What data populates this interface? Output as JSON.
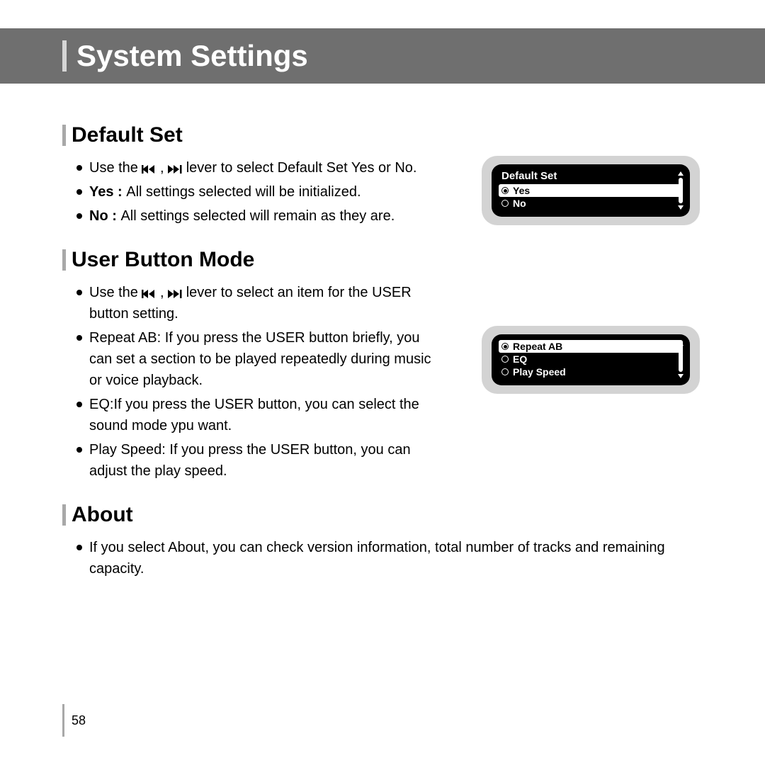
{
  "header": {
    "title": "System Settings"
  },
  "page_number": "58",
  "sections": {
    "default_set": {
      "title": "Default Set",
      "line1_a": "Use the ",
      "line1_b": " lever  to select Default Set Yes or No.",
      "yes_label": "Yes : ",
      "yes_text": "All settings selected will be initialized.",
      "no_label": "No : ",
      "no_text": "All settings selected will remain as they are.",
      "screen": {
        "title": "Default Set",
        "opt_selected": "Yes",
        "opt_other": "No"
      }
    },
    "user_button": {
      "title": "User Button Mode",
      "line1_a": "Use the ",
      "line1_b": " lever to select an item for the USER button setting.",
      "line2": "Repeat AB: If you press the USER button briefly, you can set a section to be played repeatedly during music or voice playback.",
      "line3": "EQ:If you press the USER button, you can select the sound mode ypu want.",
      "line4": "Play Speed: If you press the USER button, you can adjust the play speed.",
      "screen": {
        "opt_selected": "Repeat AB",
        "opt2": "EQ",
        "opt3": "Play Speed"
      }
    },
    "about": {
      "title": "About",
      "line1": "If you select About, you can check version information, total number of tracks and remaining capacity."
    }
  }
}
